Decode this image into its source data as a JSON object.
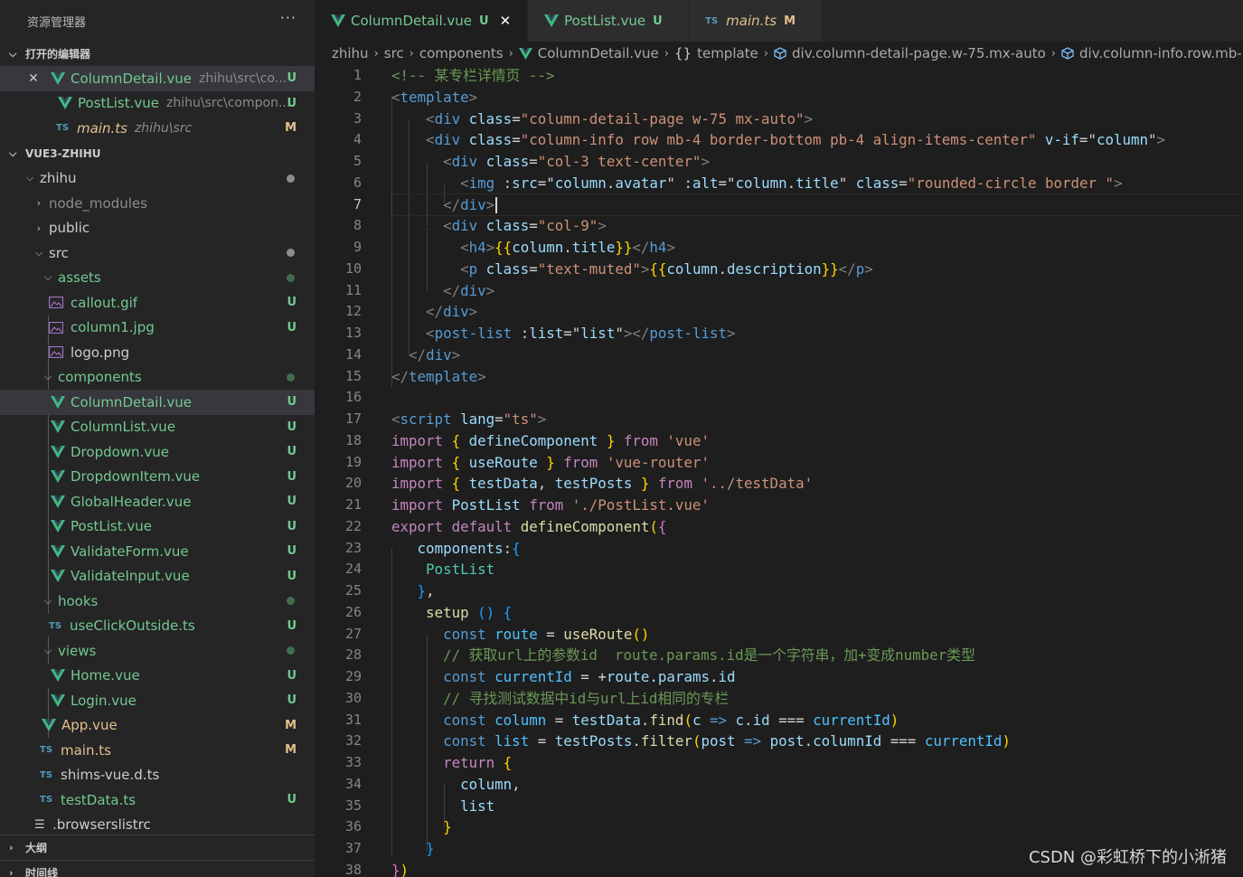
{
  "explorer": {
    "title": "资源管理器",
    "more": "···",
    "open_editors_title": "打开的编辑器",
    "open_editors": [
      {
        "name": "ColumnDetail.vue",
        "desc": "zhihu\\src\\co...",
        "status": "U"
      },
      {
        "name": "PostList.vue",
        "desc": "zhihu\\src\\compon...",
        "status": "U"
      },
      {
        "name": "main.ts",
        "desc": "zhihu\\src",
        "status": "M"
      }
    ],
    "project_title": "VUE3-ZHIHU",
    "tree": {
      "zhihu": "zhihu",
      "node_modules": "node_modules",
      "public": "public",
      "src": "src",
      "assets": "assets",
      "callout": "callout.gif",
      "column1": "column1.jpg",
      "logo": "logo.png",
      "components": "components",
      "comp_files": [
        "ColumnDetail.vue",
        "ColumnList.vue",
        "Dropdown.vue",
        "DropdownItem.vue",
        "GlobalHeader.vue",
        "PostList.vue",
        "ValidateForm.vue",
        "ValidateInput.vue"
      ],
      "hooks": "hooks",
      "useClickOutside": "useClickOutside.ts",
      "views": "views",
      "home": "Home.vue",
      "login": "Login.vue",
      "app": "App.vue",
      "main": "main.ts",
      "shims": "shims-vue.d.ts",
      "testData": "testData.ts",
      "browserslistrc": ".browserslistrc"
    },
    "status_U": "U",
    "status_M": "M",
    "outline_title": "大纲",
    "timeline_title": "时间线",
    "ts_label": "TS"
  },
  "tabs": [
    {
      "name": "ColumnDetail.vue",
      "status": "U",
      "close": "✕"
    },
    {
      "name": "PostList.vue",
      "status": "U"
    },
    {
      "name": "main.ts",
      "status": "M"
    }
  ],
  "breadcrumb": [
    "zhihu",
    "src",
    "components",
    "ColumnDetail.vue",
    "template",
    "div.column-detail-page.w-75.mx-auto",
    "div.column-info.row.mb-"
  ],
  "editor": {
    "line_numbers": [
      "1",
      "2",
      "3",
      "4",
      "5",
      "6",
      "7",
      "8",
      "9",
      "10",
      "11",
      "12",
      "13",
      "14",
      "15",
      "16",
      "17",
      "18",
      "19",
      "20",
      "21",
      "22",
      "23",
      "24",
      "25",
      "26",
      "27",
      "28",
      "29",
      "30",
      "31",
      "32",
      "33",
      "34",
      "35",
      "36",
      "37",
      "38"
    ],
    "current_line": 7
  },
  "watermark": "CSDN @彩虹桥下的小淅猪",
  "colors": {
    "untracked": "#73c991",
    "modified": "#e2c08d",
    "vue_icon": "#41b883",
    "ts_icon": "#519aba"
  }
}
